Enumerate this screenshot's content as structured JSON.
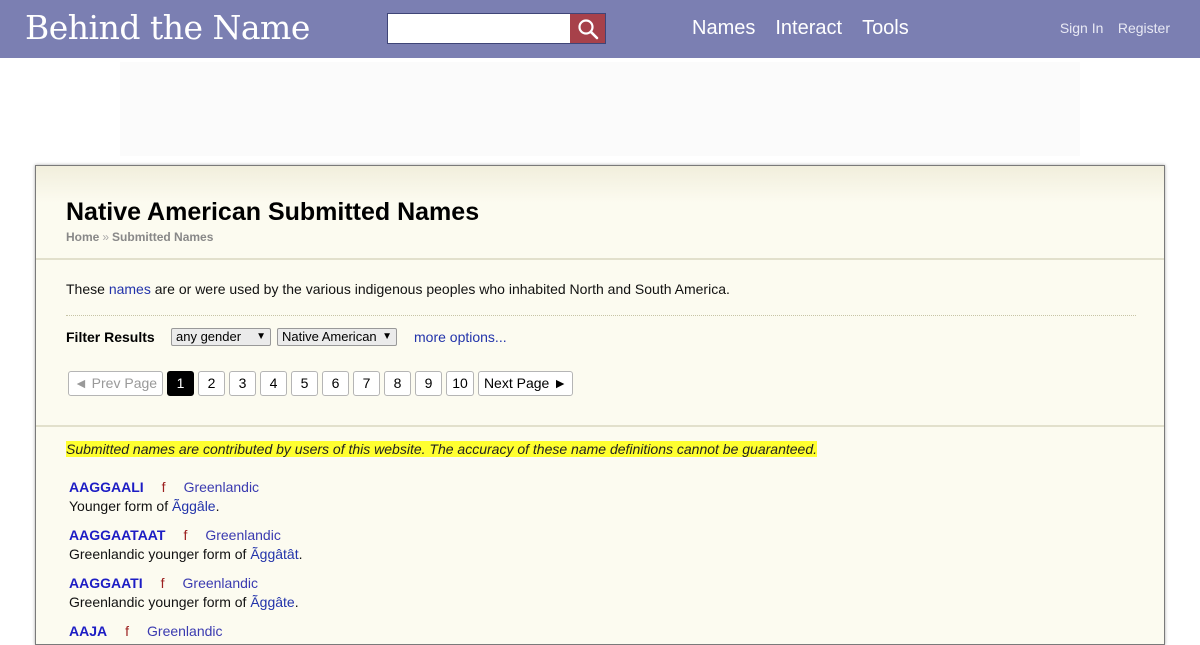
{
  "header": {
    "logo": "Behind the Name",
    "search": {
      "value": "",
      "placeholder": ""
    },
    "nav": [
      "Names",
      "Interact",
      "Tools"
    ],
    "auth": {
      "sign_in": "Sign In",
      "register": "Register"
    },
    "colors": {
      "bar": "#7b7fb2",
      "search_button": "#a7414a"
    }
  },
  "page": {
    "title": "Native American Submitted Names",
    "breadcrumb": {
      "home": "Home",
      "separator": "»",
      "current": "Submitted Names"
    },
    "intro": {
      "before": "These ",
      "link": "names",
      "after": " are or were used by the various indigenous peoples who inhabited North and South America."
    },
    "filter": {
      "label": "Filter Results",
      "gender": "any gender",
      "usage": "Native American",
      "more": "more options..."
    },
    "pager": {
      "prev": "◄ Prev Page",
      "pages": [
        "1",
        "2",
        "3",
        "4",
        "5",
        "6",
        "7",
        "8",
        "9",
        "10"
      ],
      "current": "1",
      "next": "Next Page ►"
    },
    "disclaimer": "Submitted names are contributed by users of this website. The accuracy of these name definitions cannot be guaranteed.",
    "entries": [
      {
        "name": "AAGGAALI",
        "gender": "f",
        "usage": "Greenlandic",
        "desc_before": "Younger form of ",
        "desc_link": "Ãggâle",
        "desc_after": "."
      },
      {
        "name": "AAGGAATAAT",
        "gender": "f",
        "usage": "Greenlandic",
        "desc_before": "Greenlandic younger form of ",
        "desc_link": "Ãggâtât",
        "desc_after": "."
      },
      {
        "name": "AAGGAATI",
        "gender": "f",
        "usage": "Greenlandic",
        "desc_before": "Greenlandic younger form of ",
        "desc_link": "Ãggâte",
        "desc_after": "."
      },
      {
        "name": "AAJA",
        "gender": "f",
        "usage": "Greenlandic",
        "desc_before": "",
        "desc_link": "",
        "desc_after": ""
      }
    ]
  }
}
